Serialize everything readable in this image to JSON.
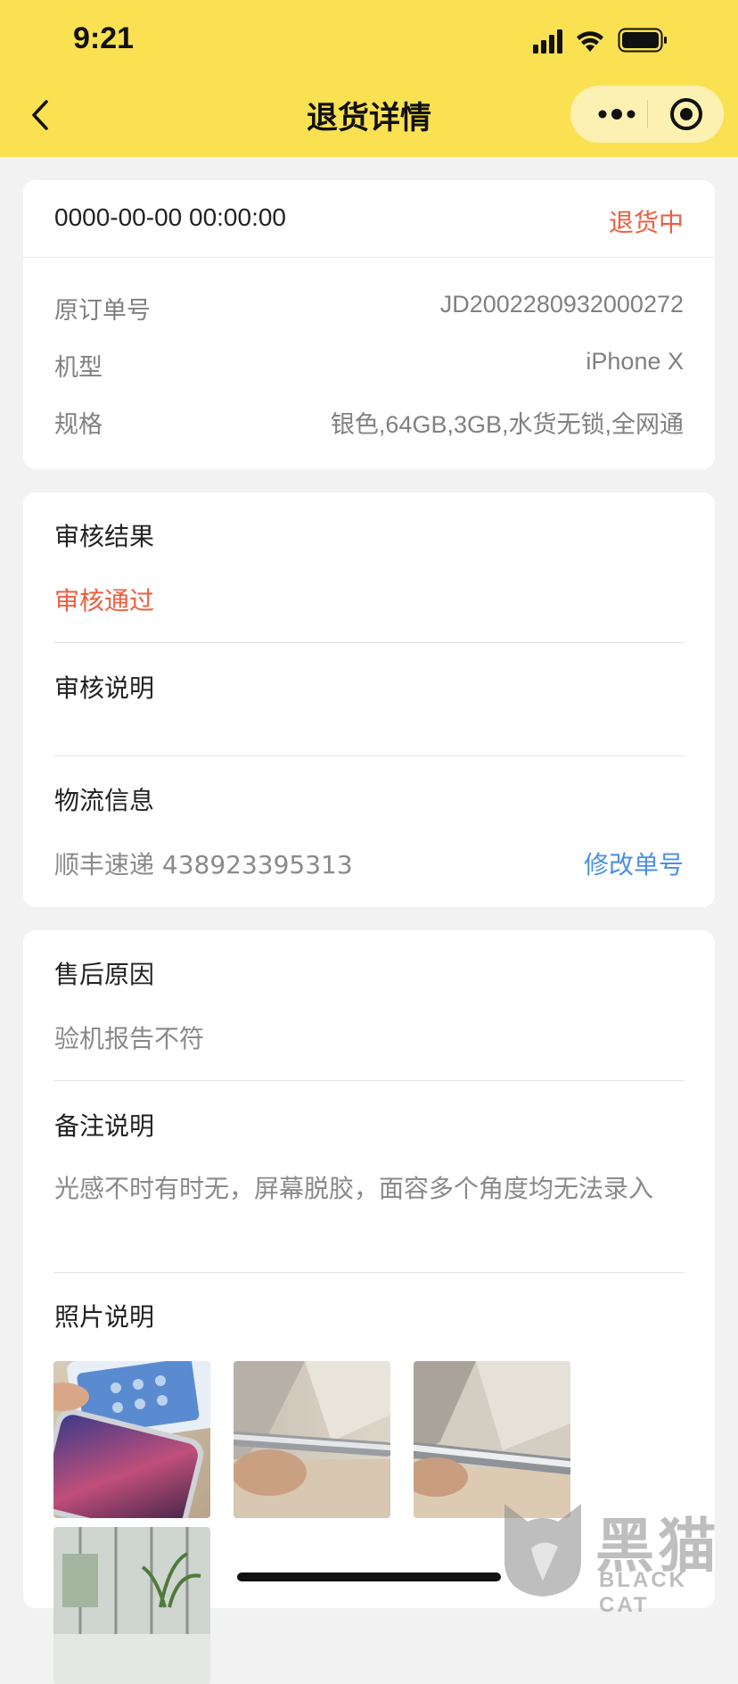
{
  "status_bar": {
    "time": "9:21"
  },
  "nav": {
    "title": "退货详情"
  },
  "order_card": {
    "datetime": "0000-00-00 00:00:00",
    "status": "退货中",
    "rows": [
      {
        "label": "原订单号",
        "value": "JD2002280932000272"
      },
      {
        "label": "机型",
        "value": "iPhone X"
      },
      {
        "label": "规格",
        "value": "银色,64GB,3GB,水货无锁,全网通"
      }
    ]
  },
  "review_card": {
    "result_title": "审核结果",
    "result_value": "审核通过",
    "note_title": "审核说明",
    "logistics_title": "物流信息",
    "logistics_value": "顺丰速递 438923395313",
    "modify_link": "修改单号"
  },
  "aftersale_card": {
    "reason_title": "售后原因",
    "reason_value": "验机报告不符",
    "remark_title": "备注说明",
    "remark_value": "光感不时有时无，屏幕脱胶，面容多个角度均无法录入",
    "photos_title": "照片说明",
    "photos": [
      "photo-1",
      "photo-2",
      "photo-3",
      "photo-4"
    ]
  },
  "watermark": {
    "cn": "黑猫",
    "en": "BLACK CAT"
  },
  "colors": {
    "header_bg": "#fae152",
    "accent_red": "#ee5d3f",
    "link_blue": "#4a90e2",
    "page_bg": "#f2f2f2"
  }
}
